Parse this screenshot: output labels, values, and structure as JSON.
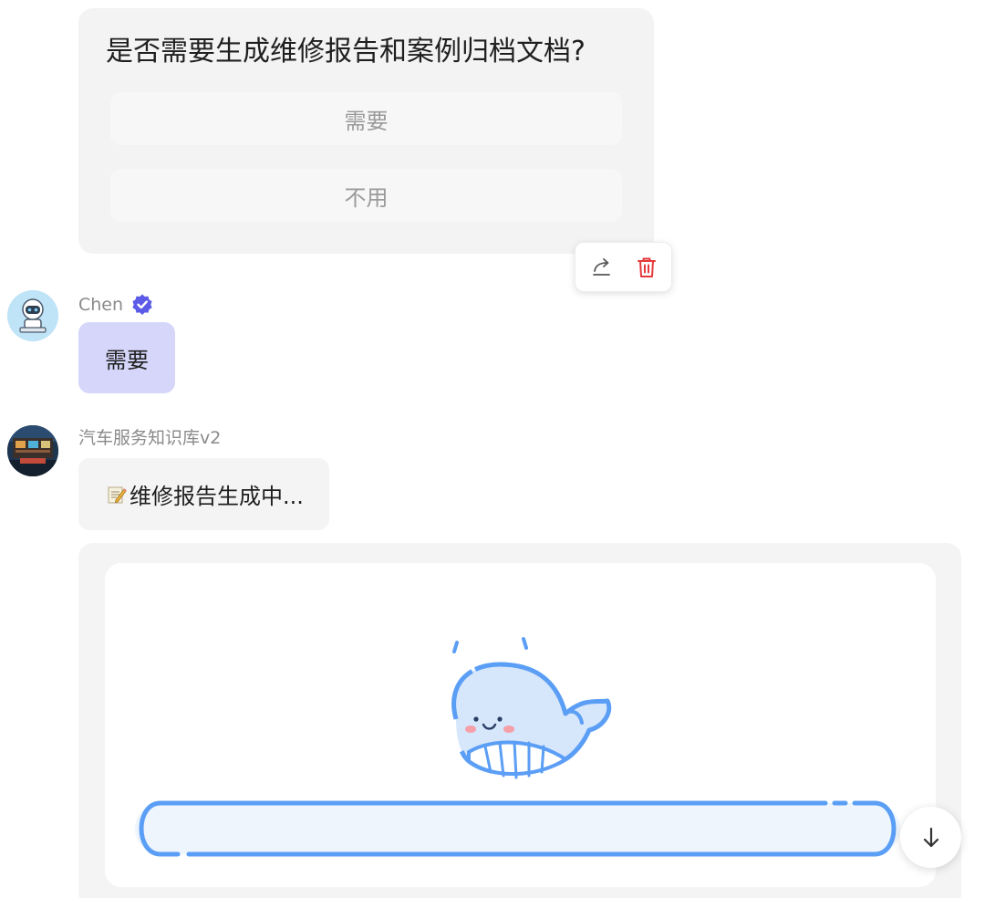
{
  "question": {
    "title": "是否需要生成维修报告和案例归档文档?",
    "options": [
      {
        "label": "需要"
      },
      {
        "label": "不用"
      }
    ]
  },
  "actions": {
    "share_icon": "share-icon",
    "delete_icon": "trash-icon",
    "delete_color": "#e5393b"
  },
  "user_message": {
    "name": "Chen",
    "verified_icon": "verified-badge-icon",
    "badge_color": "#5b5be8",
    "text": "需要",
    "bubble_color": "#d6d6fa"
  },
  "bot_message": {
    "name": "汽车服务知识库v2",
    "icon": "memo-icon",
    "text": "维修报告生成中..."
  },
  "loading": {
    "illustration": "whale-icon",
    "accent_color": "#5b9ef5"
  },
  "scroll_button": {
    "icon": "arrow-down-icon"
  }
}
